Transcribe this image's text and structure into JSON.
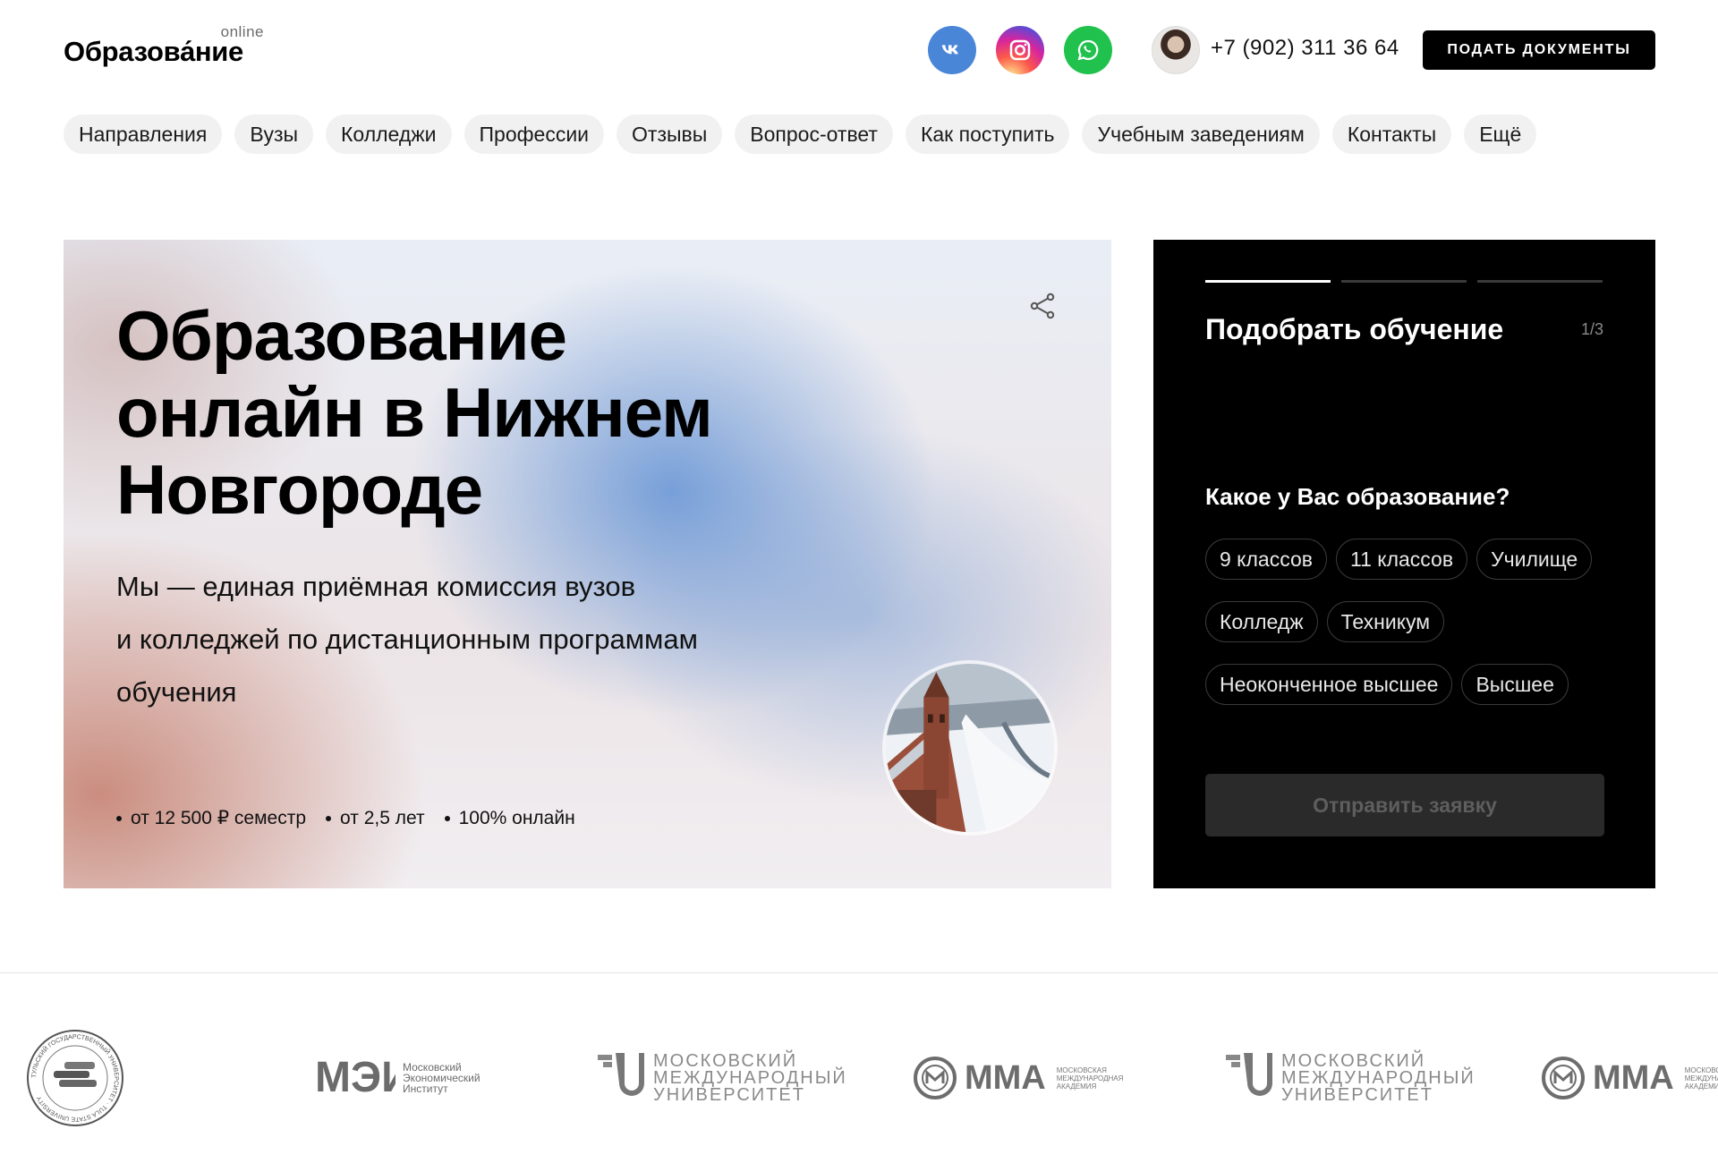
{
  "header": {
    "logo_main": "Образова́ние",
    "logo_sup": "online",
    "phone": "+7 (902) 311 36 64",
    "cta": "ПОДАТЬ ДОКУМЕНТЫ",
    "social": [
      "vk-icon",
      "instagram-icon",
      "whatsapp-icon"
    ],
    "brand_colors": {
      "vk": "#4a86d8",
      "whatsapp": "#20c14c"
    }
  },
  "nav": [
    {
      "label": "Направления"
    },
    {
      "label": "Вузы"
    },
    {
      "label": "Колледжи"
    },
    {
      "label": "Профессии"
    },
    {
      "label": "Отзывы"
    },
    {
      "label": "Вопрос-ответ"
    },
    {
      "label": "Как поступить"
    },
    {
      "label": "Учебным заведениям"
    },
    {
      "label": "Контакты"
    },
    {
      "label": "Ещё"
    }
  ],
  "hero": {
    "title_lines": [
      "Образование",
      "онлайн в Нижнем",
      "Новгороде"
    ],
    "subtitle_lines": [
      "Мы — единая приёмная комиссия вузов",
      "и колледжей по дистанционным программам",
      "обучения"
    ],
    "facts": [
      "от 12 500 ₽ семестр",
      "от 2,5 лет",
      "100% онлайн"
    ]
  },
  "quiz": {
    "title": "Подобрать обучение",
    "step": "1/3",
    "progress_total": 3,
    "progress_current": 1,
    "question": "Какое у Вас образование?",
    "options": [
      "9 классов",
      "11 классов",
      "Училище",
      "Колледж",
      "Техникум",
      "Неоконченное высшее",
      "Высшее"
    ],
    "submit": "Отправить заявку"
  },
  "partners": {
    "tula_ring": "ТУЛЬСКИЙ ГОСУДАРСТВЕННЫЙ УНИВЕРСИТЕТ · TULA STATE UNIVERSITY",
    "mei_mark": "МЭИ",
    "mei_lines": [
      "Московский",
      "Экономический",
      "Институт"
    ],
    "mmu_lines": [
      "МОСКОВСКИЙ",
      "МЕЖДУНАРОДНЫЙ",
      "УНИВЕРСИТЕТ"
    ],
    "mma_word": "ММА",
    "mma_lines": [
      "МОСКОВСКАЯ",
      "МЕЖДУНАРОДНАЯ",
      "АКАДЕМИЯ"
    ]
  }
}
